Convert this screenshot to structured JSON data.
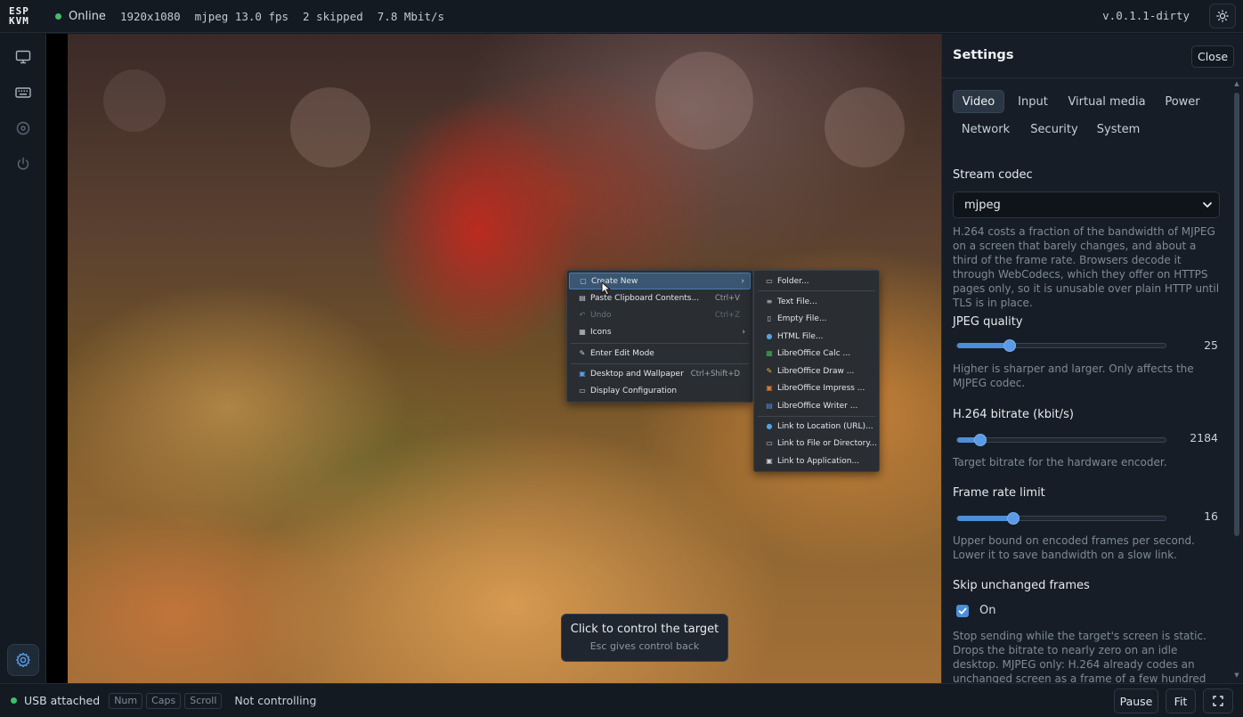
{
  "topbar": {
    "logo_line1": "ESP",
    "logo_line2": "KVM",
    "status": "Online",
    "resolution": "1920x1080",
    "stream": "mjpeg 13.0 fps",
    "skipped": "2 skipped",
    "bitrate": "7.8 Mbit/s",
    "version": "v.0.1.1-dirty",
    "theme_icon": "sun-icon"
  },
  "sidebar": {
    "items": [
      {
        "icon": "monitor-icon"
      },
      {
        "icon": "keyboard-icon"
      },
      {
        "icon": "disc-icon"
      },
      {
        "icon": "power-icon"
      }
    ],
    "settings_icon": "gear-icon"
  },
  "desktop": {
    "context_menu": [
      {
        "label": "Create New",
        "shortcut": "",
        "icon": "new-file-icon",
        "highlighted": true,
        "submenu": true
      },
      {
        "label": "Paste Clipboard Contents...",
        "shortcut": "Ctrl+V",
        "icon": "clipboard-icon"
      },
      {
        "label": "Undo",
        "shortcut": "Ctrl+Z",
        "icon": "undo-icon",
        "disabled": true
      },
      {
        "label": "Icons",
        "shortcut": "",
        "icon": "grid-icon",
        "submenu": true
      },
      {
        "label": "Enter Edit Mode",
        "shortcut": "",
        "icon": "pencil-icon"
      },
      {
        "label": "Desktop and Wallpaper",
        "shortcut": "Ctrl+Shift+D",
        "icon": "wallpaper-icon"
      },
      {
        "label": "Display Configuration",
        "shortcut": "",
        "icon": "display-icon"
      }
    ],
    "submenu": [
      {
        "label": "Folder...",
        "icon": "folder-icon"
      },
      {
        "label": "Text File...",
        "icon": "text-file-icon"
      },
      {
        "label": "Empty File...",
        "icon": "empty-file-icon"
      },
      {
        "label": "HTML File...",
        "icon": "globe-icon"
      },
      {
        "label": "LibreOffice Calc ...",
        "icon": "calc-icon"
      },
      {
        "label": "LibreOffice Draw ...",
        "icon": "draw-icon"
      },
      {
        "label": "LibreOffice Impress ...",
        "icon": "impress-icon"
      },
      {
        "label": "LibreOffice Writer ...",
        "icon": "writer-icon"
      },
      {
        "label": "Link to Location (URL)...",
        "icon": "globe-icon"
      },
      {
        "label": "Link to File or Directory...",
        "icon": "link-file-icon"
      },
      {
        "label": "Link to Application...",
        "icon": "app-icon"
      }
    ],
    "toast_title": "Click to control the target",
    "toast_sub": "Esc gives control back"
  },
  "panel": {
    "title": "Settings",
    "close_label": "Close",
    "tabs": [
      {
        "label": "Video",
        "active": true
      },
      {
        "label": "Input"
      },
      {
        "label": "Virtual media"
      },
      {
        "label": "Power"
      },
      {
        "label": "Network"
      },
      {
        "label": "Security"
      },
      {
        "label": "System"
      }
    ],
    "codec_label": "Stream codec",
    "codec_value": "mjpeg",
    "codec_help": "H.264 costs a fraction of the bandwidth of MJPEG on a screen that barely changes, and about a third of the frame rate. Browsers decode it through WebCodecs, which they offer on HTTPS pages only, so it is unusable over plain HTTP until TLS is in place.",
    "jpeg_label": "JPEG quality",
    "jpeg_value": "25",
    "jpeg_fraction": 0.25,
    "jpeg_help": "Higher is sharper and larger. Only affects the MJPEG codec.",
    "h264_label": "H.264 bitrate (kbit/s)",
    "h264_value": "2184",
    "h264_fraction": 0.11,
    "h264_help": "Target bitrate for the hardware encoder.",
    "fps_label": "Frame rate limit",
    "fps_value": "16",
    "fps_fraction": 0.27,
    "fps_help": "Upper bound on encoded frames per second. Lower it to save bandwidth on a slow link.",
    "skip_label": "Skip unchanged frames",
    "skip_value": "On",
    "skip_checked": true,
    "skip_help": "Stop sending while the target's screen is static. Drops the bitrate to nearly zero on an idle desktop. MJPEG only: H.264 already codes an unchanged screen as a frame of a few hundred bytes."
  },
  "bottombar": {
    "usb_status": "USB attached",
    "locks": [
      "Num",
      "Caps",
      "Scroll"
    ],
    "control_status": "Not controlling",
    "pause_label": "Pause",
    "fit_label": "Fit",
    "fullscreen_icon": "fullscreen-icon"
  },
  "colors": {
    "accent": "#4d8ed8",
    "online": "#3fbf6a",
    "background": "#121820"
  }
}
